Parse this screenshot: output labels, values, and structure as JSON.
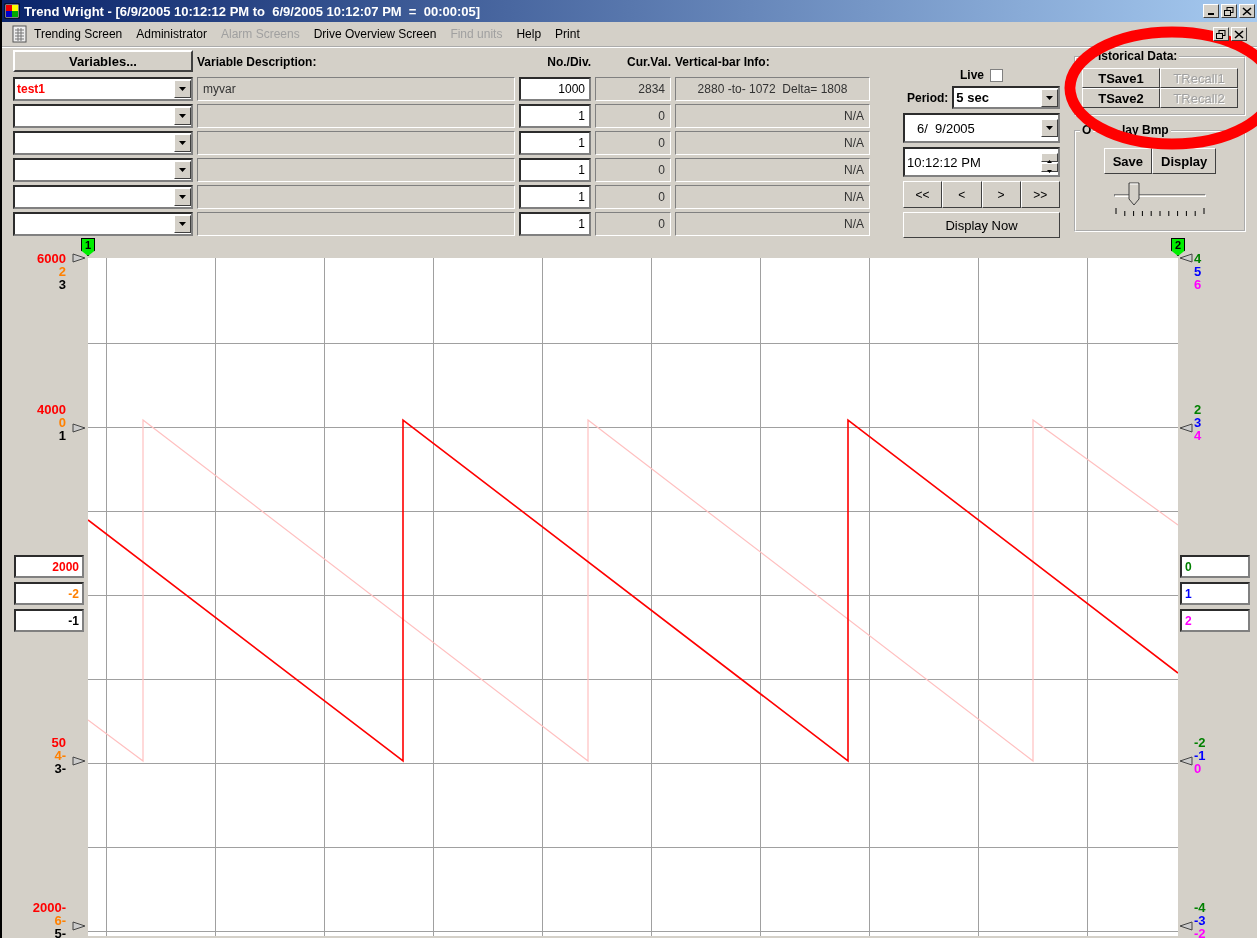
{
  "window": {
    "title": "Trend Wright - [6/9/2005 10:12:12 PM to  6/9/2005 10:12:07 PM  =  00:00:05]"
  },
  "menu": [
    {
      "label": "Trending Screen",
      "disabled": false
    },
    {
      "label": "Administrator",
      "disabled": false
    },
    {
      "label": "Alarm Screens",
      "disabled": true
    },
    {
      "label": "Drive Overview Screen",
      "disabled": false
    },
    {
      "label": "Find units",
      "disabled": true
    },
    {
      "label": "Help",
      "disabled": false
    },
    {
      "label": "Print",
      "disabled": false
    }
  ],
  "variables_button": "Variables...",
  "columns": [
    "Variable Description:",
    "No./Div.",
    "Cur.Val.",
    "Vertical-bar Info:"
  ],
  "rows": [
    {
      "variable": "test1",
      "color": "#ff0000",
      "description": "myvar",
      "per_div": "1000",
      "cur_val": "2834",
      "bar_info": "2880 -to- 1072  Delta= 1808"
    },
    {
      "per_div": "1",
      "cur_val": "0",
      "bar_info": "N/A"
    },
    {
      "per_div": "1",
      "cur_val": "0",
      "bar_info": "N/A"
    },
    {
      "per_div": "1",
      "cur_val": "0",
      "bar_info": "N/A"
    },
    {
      "per_div": "1",
      "cur_val": "0",
      "bar_info": "N/A"
    },
    {
      "per_div": "1",
      "cur_val": "0",
      "bar_info": "N/A"
    }
  ],
  "live": {
    "label": "Live",
    "checked": false
  },
  "period": {
    "label": "Period:",
    "value": "5 sec"
  },
  "date": "6/  9/2005",
  "time": "10:12:12 PM",
  "nav_buttons": [
    "<<",
    "<",
    ">",
    ">>"
  ],
  "display_now": "Display Now",
  "historical": {
    "label": "istorical Data:",
    "buttons": [
      {
        "label": "TSave1",
        "disabled": false
      },
      {
        "label": "TRecall1",
        "disabled": true
      },
      {
        "label": "TSave2",
        "disabled": false
      },
      {
        "label": "TRecall2",
        "disabled": true
      }
    ]
  },
  "overlay": {
    "label_parts": [
      "O",
      "lay Bmp"
    ],
    "buttons": [
      "Save",
      "Display"
    ],
    "slider": {
      "level": 0.18
    }
  },
  "chart": {
    "markers": [
      "1",
      "2"
    ],
    "left_axis": [
      [
        {
          "text": "6000",
          "color": "#ff0000"
        },
        {
          "text": "2",
          "color": "#ff8000"
        },
        {
          "text": "3",
          "color": "#000000"
        }
      ],
      [
        {
          "text": "4000",
          "color": "#ff0000"
        },
        {
          "text": "0",
          "color": "#ff8000"
        },
        {
          "text": "1",
          "color": "#000000"
        }
      ],
      [
        {
          "text": "50",
          "color": "#ff0000"
        },
        {
          "text": "4-",
          "color": "#ff8000"
        },
        {
          "text": "3-",
          "color": "#000000"
        }
      ],
      [
        {
          "text": "2000-",
          "color": "#ff0000"
        },
        {
          "text": "6-",
          "color": "#ff8000"
        },
        {
          "text": "5-",
          "color": "#000000"
        }
      ]
    ],
    "right_axis": [
      [
        {
          "text": "4",
          "color": "#008000"
        },
        {
          "text": "5",
          "color": "#0000ff"
        },
        {
          "text": "6",
          "color": "#ff00ff"
        }
      ],
      [
        {
          "text": "2",
          "color": "#008000"
        },
        {
          "text": "3",
          "color": "#0000ff"
        },
        {
          "text": "4",
          "color": "#ff00ff"
        }
      ],
      [
        {
          "text": "-2",
          "color": "#008000"
        },
        {
          "text": "-1",
          "color": "#0000ff"
        },
        {
          "text": "0",
          "color": "#ff00ff"
        }
      ],
      [
        {
          "text": "-4",
          "color": "#008000"
        },
        {
          "text": "-3",
          "color": "#0000ff"
        },
        {
          "text": "-2",
          "color": "#ff00ff"
        }
      ]
    ],
    "left_fields": [
      {
        "value": "2000",
        "color": "#ff0000"
      },
      {
        "value": "-2",
        "color": "#ff8000"
      },
      {
        "value": "-1",
        "color": "#000000"
      }
    ],
    "right_fields": [
      {
        "value": "0",
        "color": "#008000"
      },
      {
        "value": "1",
        "color": "#0000ff"
      },
      {
        "value": "2",
        "color": "#ff00ff"
      }
    ]
  },
  "highlight": {
    "kind": "ellipse"
  }
}
